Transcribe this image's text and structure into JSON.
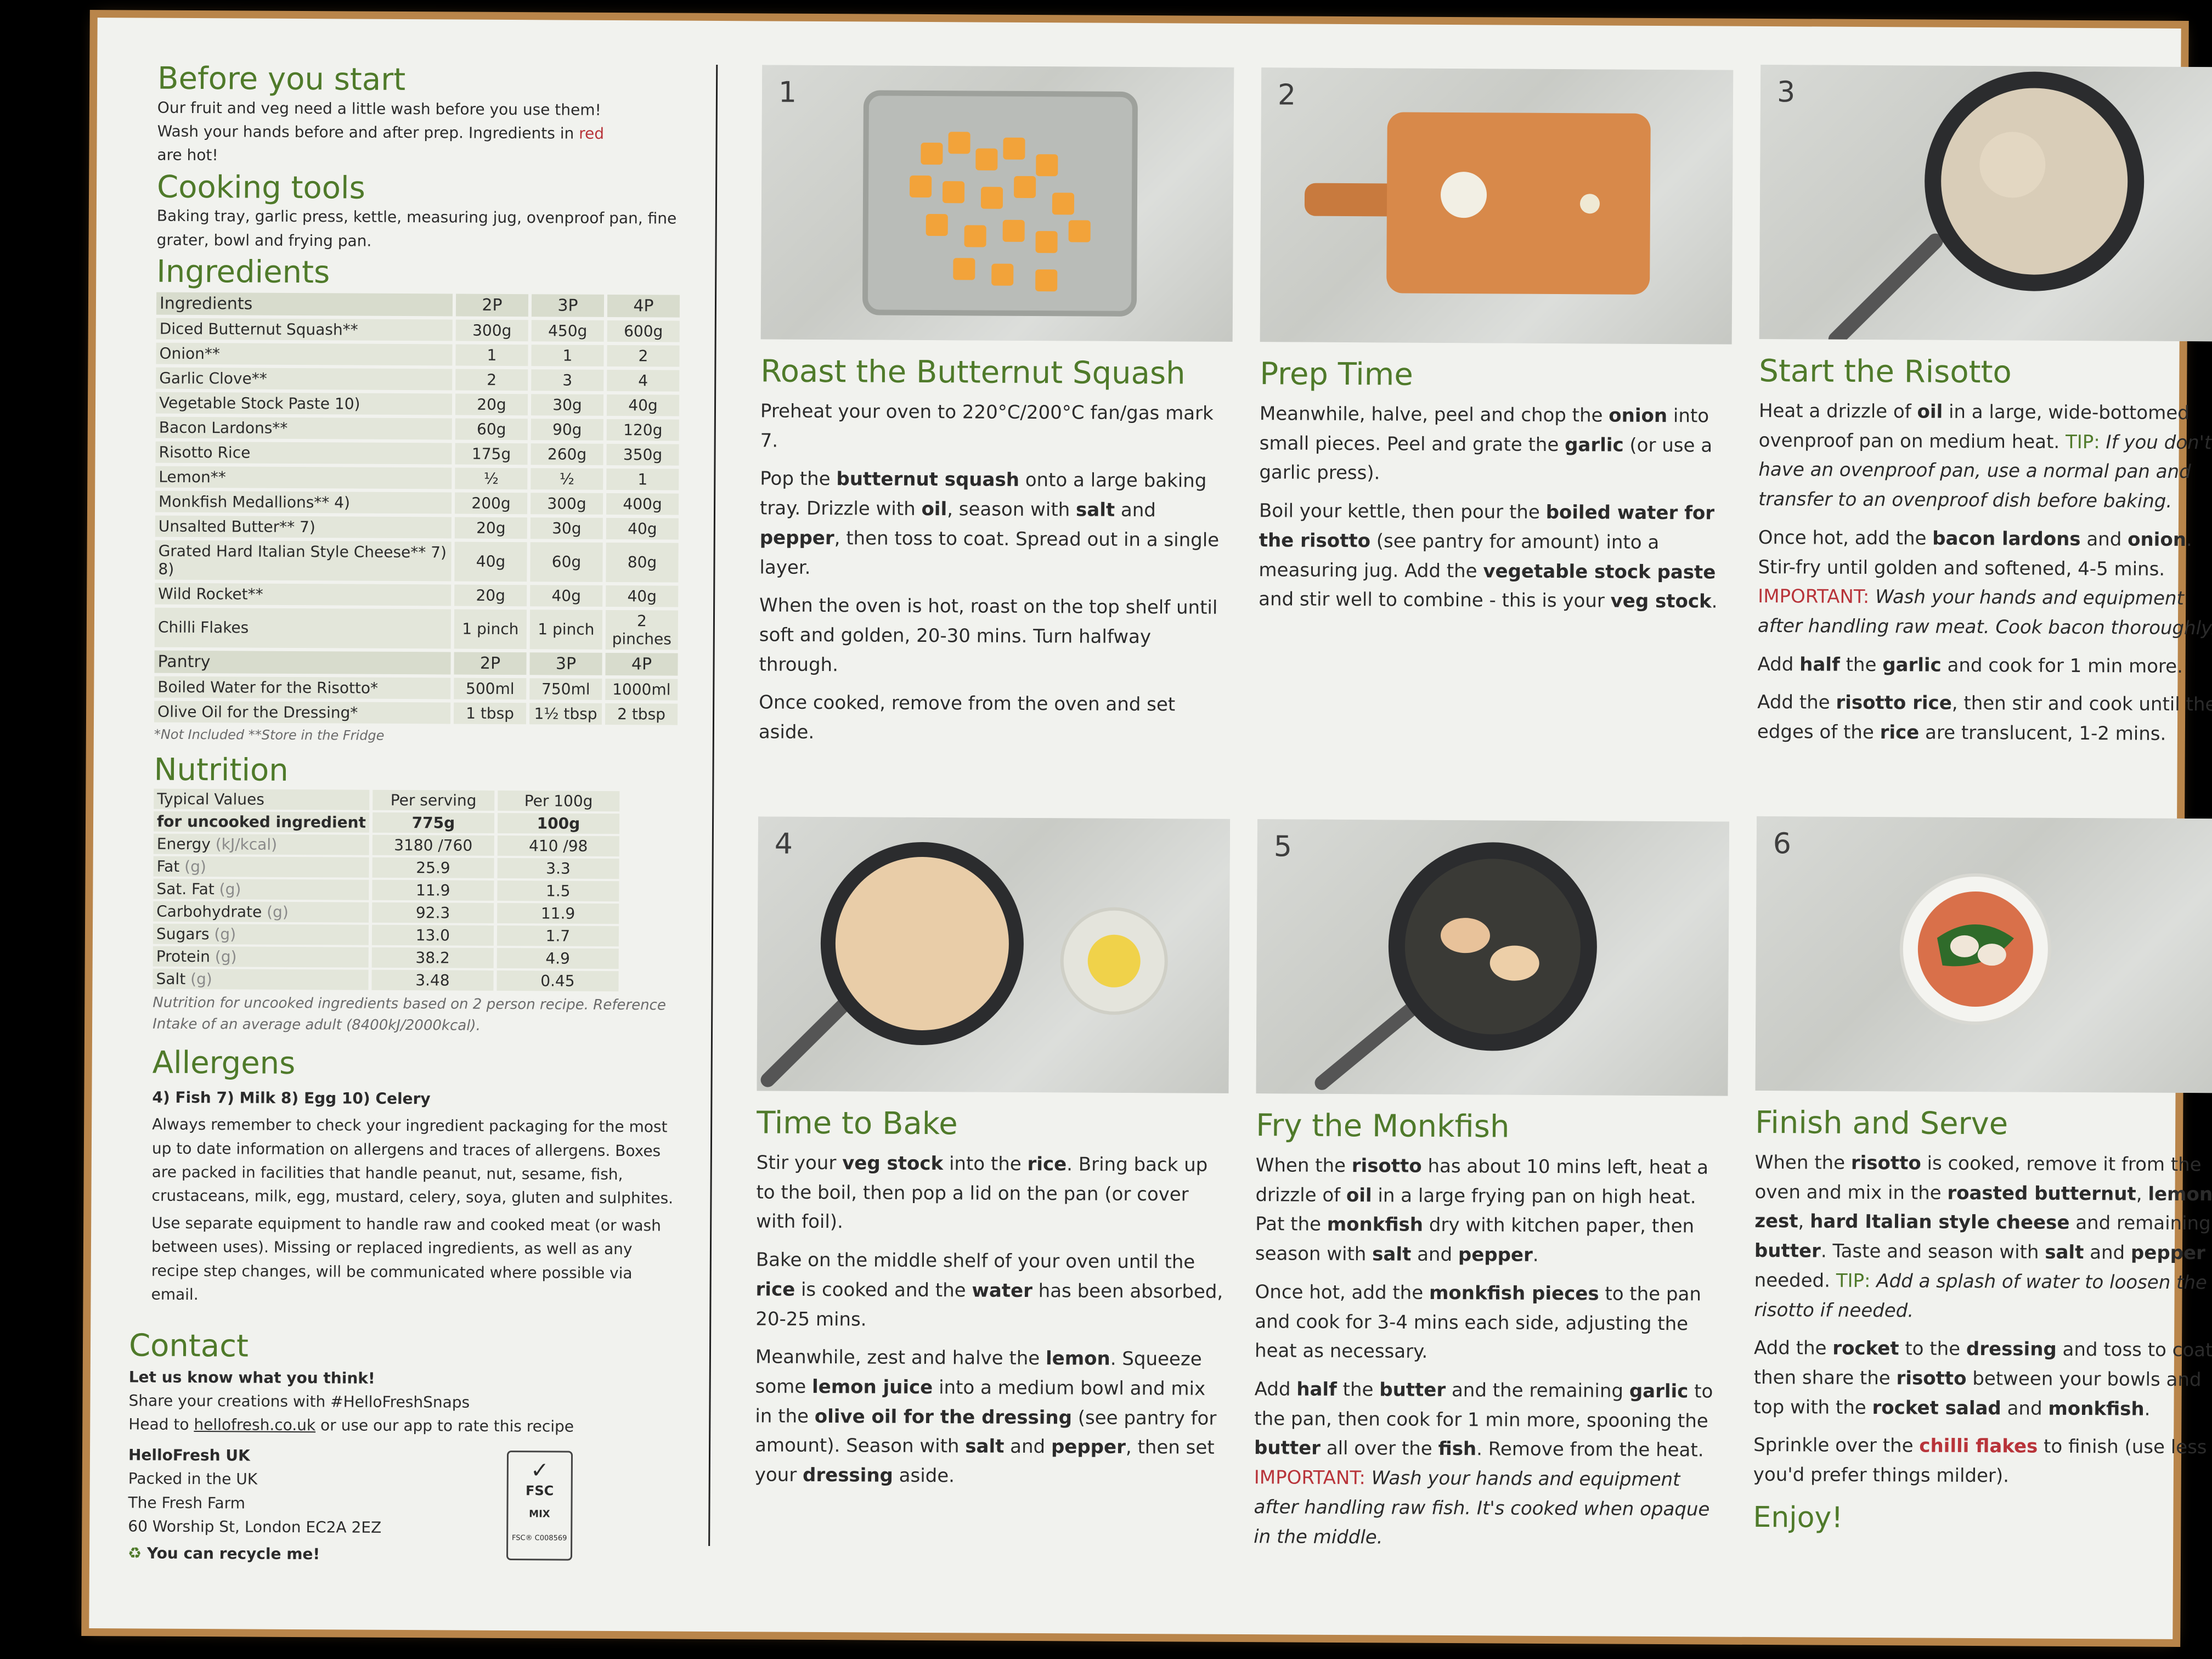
{
  "before": {
    "title": "Before you start",
    "l1": "Our fruit and veg need a little wash before you use them!",
    "l2": "Wash your hands before and after prep. Ingredients in ",
    "l2_red": "red",
    "l3": "are hot!"
  },
  "tools": {
    "title": "Cooking tools",
    "text": "Baking tray, garlic press, kettle, measuring jug, ovenproof pan, fine grater, bowl and frying pan."
  },
  "ingredients": {
    "title": "Ingredients",
    "header": [
      "Ingredients",
      "2P",
      "3P",
      "4P"
    ],
    "rows": [
      [
        "Diced Butternut Squash**",
        "300g",
        "450g",
        "600g"
      ],
      [
        "Onion**",
        "1",
        "1",
        "2"
      ],
      [
        "Garlic Clove**",
        "2",
        "3",
        "4"
      ],
      [
        "Vegetable Stock Paste 10)",
        "20g",
        "30g",
        "40g"
      ],
      [
        "Bacon Lardons**",
        "60g",
        "90g",
        "120g"
      ],
      [
        "Risotto Rice",
        "175g",
        "260g",
        "350g"
      ],
      [
        "Lemon**",
        "½",
        "½",
        "1"
      ],
      [
        "Monkfish Medallions** 4)",
        "200g",
        "300g",
        "400g"
      ],
      [
        "Unsalted Butter** 7)",
        "20g",
        "30g",
        "40g"
      ],
      [
        "Grated Hard Italian Style Cheese** 7) 8)",
        "40g",
        "60g",
        "80g"
      ],
      [
        "Wild Rocket**",
        "20g",
        "40g",
        "40g"
      ],
      [
        "Chilli Flakes",
        "1 pinch",
        "1 pinch",
        "2 pinches"
      ]
    ],
    "pantry_header": [
      "Pantry",
      "2P",
      "3P",
      "4P"
    ],
    "pantry_rows": [
      [
        "Boiled Water for the Risotto*",
        "500ml",
        "750ml",
        "1000ml"
      ],
      [
        "Olive Oil for the Dressing*",
        "1 tbsp",
        "1½ tbsp",
        "2 tbsp"
      ]
    ],
    "note": "*Not Included  **Store in the Fridge"
  },
  "nutrition": {
    "title": "Nutrition",
    "header": [
      "Typical Values",
      "Per serving",
      "Per 100g"
    ],
    "sub": [
      "for uncooked ingredient",
      "775g",
      "100g"
    ],
    "rows": [
      [
        "Energy",
        "(kJ/kcal)",
        "3180 /760",
        "410 /98"
      ],
      [
        "Fat",
        "(g)",
        "25.9",
        "3.3"
      ],
      [
        "Sat. Fat",
        "(g)",
        "11.9",
        "1.5"
      ],
      [
        "Carbohydrate",
        "(g)",
        "92.3",
        "11.9"
      ],
      [
        "Sugars",
        "(g)",
        "13.0",
        "1.7"
      ],
      [
        "Protein",
        "(g)",
        "38.2",
        "4.9"
      ],
      [
        "Salt",
        "(g)",
        "3.48",
        "0.45"
      ]
    ],
    "note": "Nutrition for uncooked ingredients based on 2 person recipe. Reference Intake of an average adult (8400kJ/2000kcal)."
  },
  "allergens": {
    "title": "Allergens",
    "list": "4) Fish 7) Milk 8) Egg 10) Celery",
    "p1": "Always remember to check your ingredient packaging for the most up to date information on allergens and traces of allergens. Boxes are packed in facilities that handle peanut, nut, sesame, fish, crustaceans, milk, egg, mustard, celery, soya, gluten and sulphites.",
    "p2": "Use separate equipment to handle raw and cooked meat (or wash between uses). Missing or replaced ingredients, as well as any recipe step changes, will be communicated where possible via email."
  },
  "contact": {
    "title": "Contact",
    "l1": "Let us know what you think!",
    "l2": "Share your creations with #HelloFreshSnaps",
    "l3a": "Head to ",
    "l3link": "hellofresh.co.uk",
    "l3b": " or use our app to rate this recipe",
    "company": "HelloFresh UK",
    "a1": "Packed in the UK",
    "a2": "The Fresh Farm",
    "a3": "60 Worship St, London EC2A 2EZ",
    "recycle": "You can recycle me!",
    "fsc": "FSC",
    "fsc_mix": "MIX",
    "fsc_code": "FSC® C008569"
  },
  "steps": [
    {
      "num": "1",
      "title": "Roast the Butternut Squash"
    },
    {
      "num": "2",
      "title": "Prep Time"
    },
    {
      "num": "3",
      "title": "Start the Risotto"
    },
    {
      "num": "4",
      "title": "Time to Bake"
    },
    {
      "num": "5",
      "title": "Fry the Monkfish"
    },
    {
      "num": "6",
      "title": "Finish and Serve"
    }
  ],
  "s1": {
    "p1": "Preheat your oven to 220°C/200°C fan/gas mark 7.",
    "p2a": "Pop the ",
    "p2b": "butternut squash",
    "p2c": " onto a large baking tray. Drizzle with ",
    "p2d": "oil",
    "p2e": ", season with ",
    "p2f": "salt",
    "p2g": " and ",
    "p2h": "pepper",
    "p2i": ", then toss to coat. Spread out in a single layer.",
    "p3": "When the oven is hot, roast on the top shelf until soft and golden, 20-30 mins. Turn halfway through.",
    "p4": "Once cooked, remove from the oven and set aside."
  },
  "s2": {
    "p1a": "Meanwhile, halve, peel and chop the ",
    "p1b": "onion",
    "p1c": " into small pieces. Peel and grate the ",
    "p1d": "garlic",
    "p1e": " (or use a garlic press).",
    "p2a": "Boil your kettle, then pour the ",
    "p2b": "boiled water for the risotto",
    "p2c": " (see pantry for amount) into a measuring jug. Add the ",
    "p2d": "vegetable stock paste",
    "p2e": " and stir well to combine - this is your ",
    "p2f": "veg stock",
    "p2g": "."
  },
  "s3": {
    "p1a": "Heat a drizzle of ",
    "p1b": "oil",
    "p1c": " in a large, wide-bottomed ovenproof pan on medium heat. ",
    "tip": "TIP:",
    "p1d": " If you don't have an ovenproof pan, use a normal pan and transfer to an ovenproof dish before baking.",
    "p2a": "Once hot, add the ",
    "p2b": "bacon lardons",
    "p2c": " and ",
    "p2d": "onion",
    "p2e": ". Stir-fry until golden and softened, 4-5 mins. ",
    "imp": "IMPORTANT:",
    "p2f": " Wash your hands and equipment after handling raw meat. Cook bacon thoroughly.",
    "p3a": "Add ",
    "p3b": "half",
    "p3c": " the ",
    "p3d": "garlic",
    "p3e": " and cook for 1 min more.",
    "p4a": "Add the ",
    "p4b": "risotto rice",
    "p4c": ", then stir and cook until the edges of the ",
    "p4d": "rice",
    "p4e": " are translucent, 1-2 mins."
  },
  "s4": {
    "p1a": "Stir your ",
    "p1b": "veg stock",
    "p1c": " into the ",
    "p1d": "rice",
    "p1e": ". Bring back up to the boil, then pop a lid on the pan (or cover with foil).",
    "p2a": "Bake on the middle shelf of your oven until the ",
    "p2b": "rice",
    "p2c": " is cooked and the ",
    "p2d": "water",
    "p2e": " has been absorbed, 20-25 mins.",
    "p3a": "Meanwhile, zest and halve the ",
    "p3b": "lemon",
    "p3c": ". Squeeze some ",
    "p3d": "lemon juice",
    "p3e": " into a medium bowl and mix in the ",
    "p3f": "olive oil for the dressing",
    "p3g": " (see pantry for amount). Season with ",
    "p3h": "salt",
    "p3i": " and ",
    "p3j": "pepper",
    "p3k": ", then set your ",
    "p3l": "dressing",
    "p3m": " aside."
  },
  "s5": {
    "p1a": "When the ",
    "p1b": "risotto",
    "p1c": " has about 10 mins left, heat a drizzle of ",
    "p1d": "oil",
    "p1e": " in a large frying pan on high heat. Pat the ",
    "p1f": "monkfish",
    "p1g": " dry with kitchen paper, then season with ",
    "p1h": "salt",
    "p1i": " and ",
    "p1j": "pepper",
    "p1k": ".",
    "p2a": "Once hot, add the ",
    "p2b": "monkfish pieces",
    "p2c": " to the pan and cook for 3-4 mins each side, adjusting the heat as necessary.",
    "p3a": "Add ",
    "p3b": "half",
    "p3c": " the ",
    "p3d": "butter",
    "p3e": " and the remaining ",
    "p3f": "garlic",
    "p3g": " to the pan, then cook for 1 min more, spooning the ",
    "p3h": "butter",
    "p3i": " all over the ",
    "p3j": "fish",
    "p3k": ". Remove from the heat. ",
    "imp": "IMPORTANT:",
    "p3l": " Wash your hands and equipment after handling raw fish. It's cooked when opaque in the middle."
  },
  "s6": {
    "p1a": "When the ",
    "p1b": "risotto",
    "p1c": " is cooked, remove it from the oven and mix in the ",
    "p1d": "roasted butternut",
    "p1e": ", ",
    "p1f": "lemon zest",
    "p1g": ", ",
    "p1h": "hard Italian style cheese",
    "p1i": " and remaining ",
    "p1j": "butter",
    "p1k": ". Taste and season with ",
    "p1l": "salt",
    "p1m": " and ",
    "p1n": "pepper",
    "p1o": " if needed. ",
    "tip": "TIP:",
    "p1p": " Add a splash of water to loosen the risotto if needed.",
    "p2a": "Add the ",
    "p2b": "rocket",
    "p2c": " to the ",
    "p2d": "dressing",
    "p2e": " and toss to coat, then share the ",
    "p2f": "risotto",
    "p2g": " between your bowls and top with the ",
    "p2h": "rocket salad",
    "p2i": " and ",
    "p2j": "monkfish",
    "p2k": ".",
    "p3a": "Sprinkle over the ",
    "p3b": "chilli flakes",
    "p3c": " to finish (use less if you'd prefer things milder).",
    "enjoy": "Enjoy!"
  },
  "colors": {
    "green": "#4f7a2a",
    "red": "#b8343a",
    "card": "#f1f2ee",
    "cardboard": "#b9854a"
  }
}
